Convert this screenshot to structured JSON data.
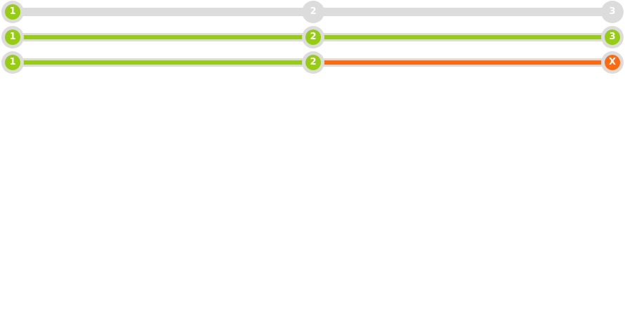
{
  "colors": {
    "inactive": "#dcdcdc",
    "complete": "#96cc12",
    "error": "#ff6a0f"
  },
  "steppers": [
    {
      "steps": [
        {
          "label": "1",
          "state": "complete"
        },
        {
          "label": "2",
          "state": "inactive"
        },
        {
          "label": "3",
          "state": "inactive"
        }
      ],
      "connectors": [
        "inactive",
        "inactive"
      ]
    },
    {
      "steps": [
        {
          "label": "1",
          "state": "complete"
        },
        {
          "label": "2",
          "state": "complete"
        },
        {
          "label": "3",
          "state": "complete"
        }
      ],
      "connectors": [
        "complete",
        "complete"
      ]
    },
    {
      "steps": [
        {
          "label": "1",
          "state": "complete"
        },
        {
          "label": "2",
          "state": "complete"
        },
        {
          "label": "X",
          "state": "error"
        }
      ],
      "connectors": [
        "complete",
        "error"
      ]
    }
  ]
}
